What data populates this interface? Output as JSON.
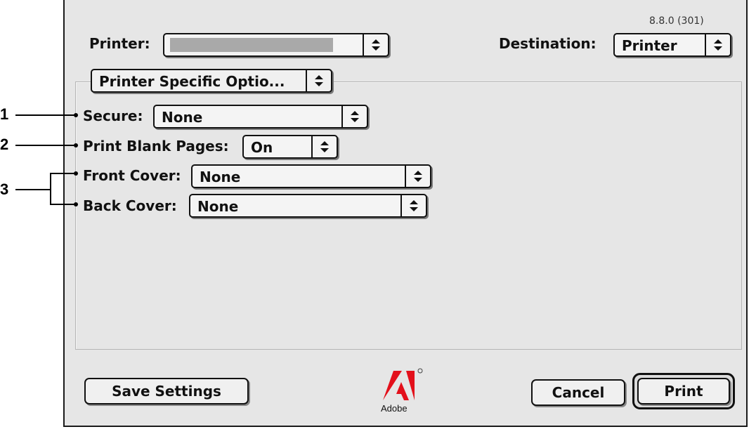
{
  "dialog": {
    "version": "8.8.0 (301)",
    "printer_label": "Printer:",
    "destination_label": "Destination:",
    "destination_value": "Printer",
    "panel_menu_value": "Printer Specific Optio...",
    "options": [
      {
        "label": "Secure:",
        "value": "None"
      },
      {
        "label": "Print Blank Pages:",
        "value": "On"
      },
      {
        "label": "Front Cover:",
        "value": "None"
      },
      {
        "label": "Back Cover:",
        "value": "None"
      }
    ],
    "buttons": {
      "save": "Save Settings",
      "cancel": "Cancel",
      "print": "Print"
    },
    "logo_text": "Adobe"
  },
  "callouts": [
    "1",
    "2",
    "3"
  ]
}
